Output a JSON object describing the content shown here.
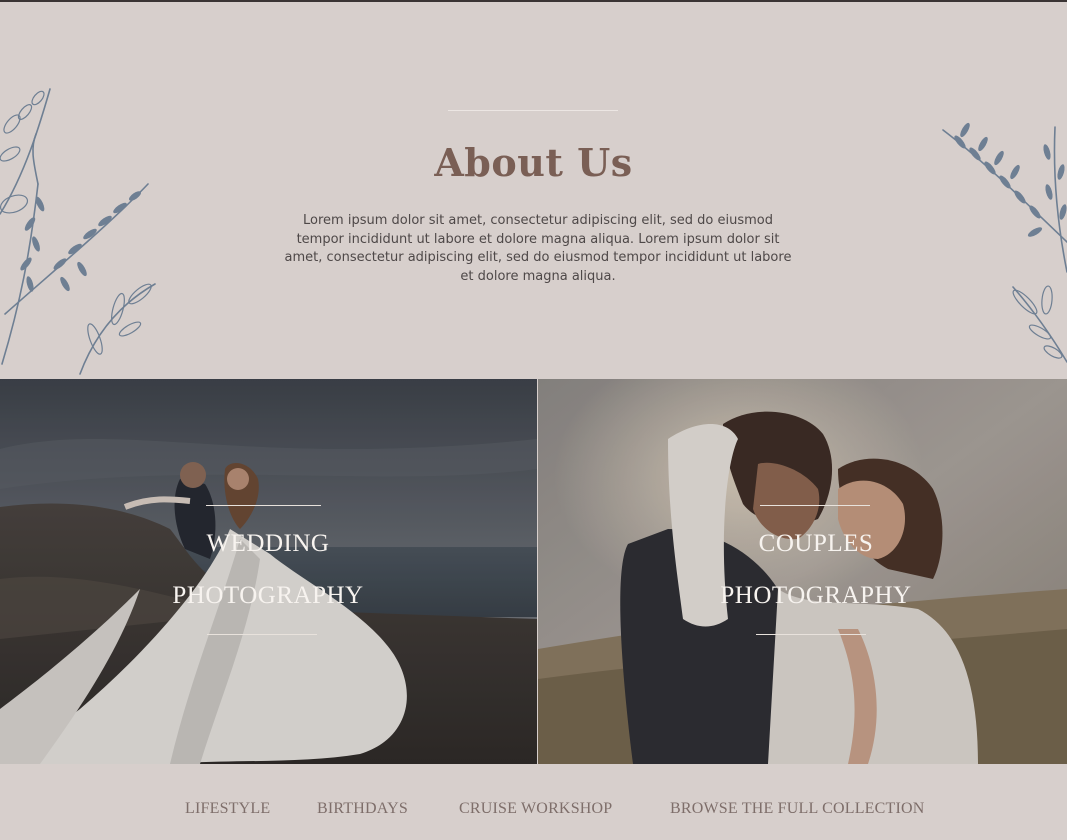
{
  "about": {
    "title": "About Us",
    "text": "Lorem ipsum dolor sit amet, consectetur adipiscing elit, sed do eiusmod tempor incididunt ut labore et dolore magna aliqua. Lorem ipsum dolor sit amet, consectetur adipiscing elit, sed do eiusmod tempor incididunt ut labore et dolore magna aliqua."
  },
  "gallery": {
    "wedding": {
      "line1": "WEDDING",
      "line2": "PHOTOGRAPHY"
    },
    "couples": {
      "line1": "COUPLES",
      "line2": "PHOTOGRAPHY"
    }
  },
  "nav": {
    "items": [
      {
        "label": "LIFESTYLE"
      },
      {
        "label": "BIRTHDAYS"
      },
      {
        "label": "CRUISE WORKSHOP"
      },
      {
        "label": "BROWSE THE FULL COLLECTION"
      }
    ]
  },
  "colors": {
    "background": "#d7cfcc",
    "title": "#7a5f55",
    "floral": "#6e7f93",
    "nav": "#7e6e6a"
  }
}
